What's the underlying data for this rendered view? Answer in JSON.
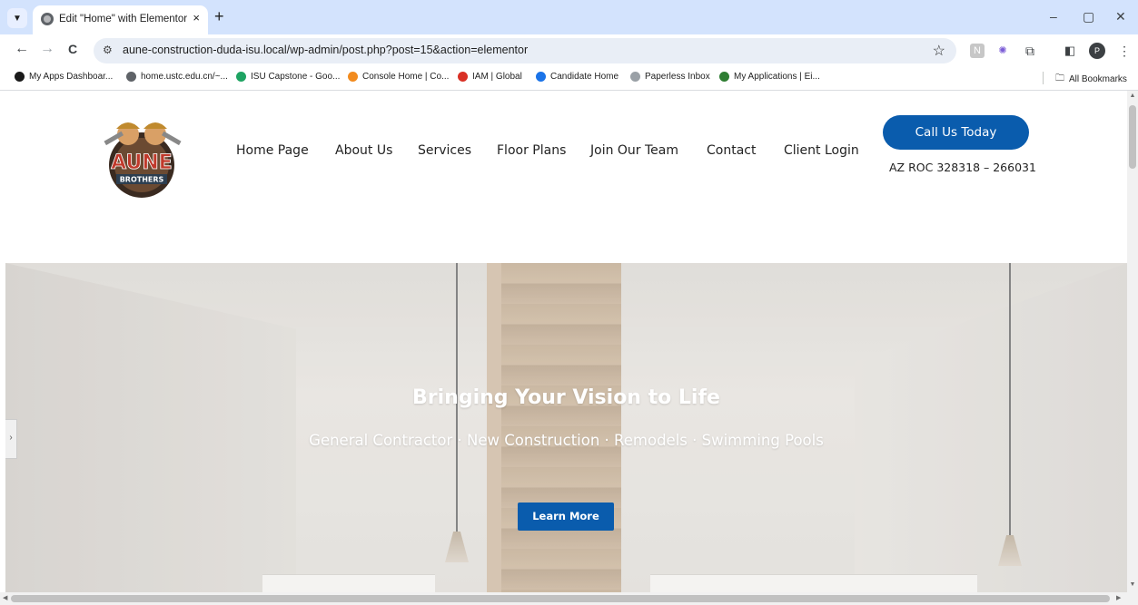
{
  "browser": {
    "tab_list_icon": "chevron-down-icon",
    "tab_title": "Edit \"Home\" with Elementor",
    "tab_close": "×",
    "new_tab": "+",
    "win_minimize": "–",
    "win_restore": "▢",
    "win_close": "✕",
    "back": "←",
    "forward": "→",
    "reload": "C",
    "url": "aune-construction-duda-isu.local/wp-admin/post.php?post=15&action=elementor",
    "profile_initial": "P"
  },
  "bookmarks": [
    {
      "label": "My Apps Dashboar...",
      "color": "#1a1a1a"
    },
    {
      "label": "home.ustc.edu.cn/~...",
      "color": "#5f6368"
    },
    {
      "label": "ISU Capstone - Goo...",
      "color": "#1ea362"
    },
    {
      "label": "Console Home | Co...",
      "color": "#f28b1e"
    },
    {
      "label": "IAM | Global",
      "color": "#d93025"
    },
    {
      "label": "Candidate Home",
      "color": "#1a73e8"
    },
    {
      "label": "Paperless Inbox",
      "color": "#9aa0a6"
    },
    {
      "label": "My Applications | Ei...",
      "color": "#2e7d32"
    }
  ],
  "all_bookmarks": "All Bookmarks",
  "site": {
    "logo_text": "AUNE BROTHERS",
    "nav": [
      "Home Page",
      "About Us",
      "Services",
      "Floor Plans",
      "Join Our Team",
      "Contact",
      "Client Login"
    ],
    "cta_label": "Call Us Today",
    "license": "AZ ROC 328318 – 266031"
  },
  "hero": {
    "title": "Bringing Your Vision to Life",
    "subtitle": "General Contractor · New Construction · Remodels · Swimming Pools",
    "button": "Learn More"
  },
  "colors": {
    "brand_blue": "#0a5cad",
    "tabbar": "#d3e3fd"
  }
}
